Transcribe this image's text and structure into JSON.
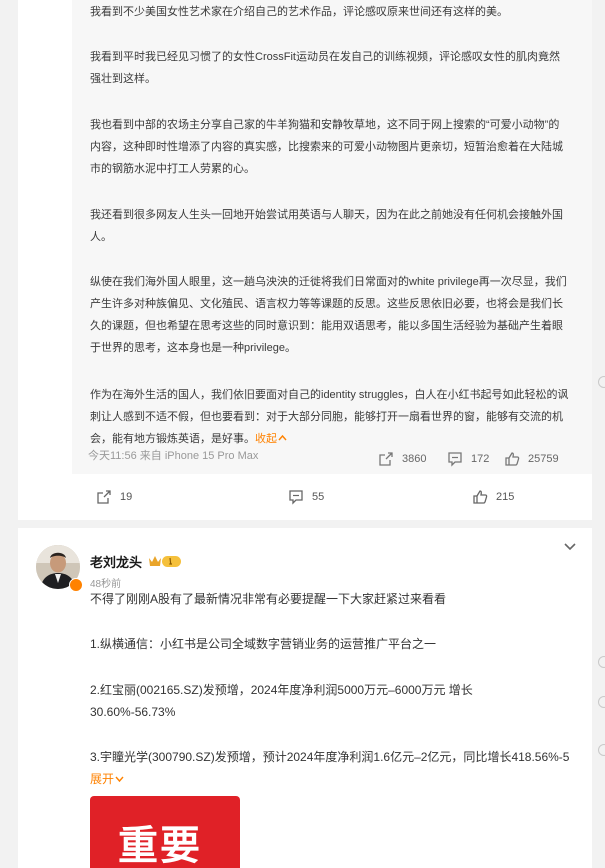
{
  "repost": {
    "paragraphs": [
      "我看到不少美国女性艺术家在介绍自己的艺术作品，评论感叹原来世间还有这样的美。",
      "我看到平时我已经见习惯了的女性CrossFit运动员在发自己的训练视频，评论感叹女性的肌肉竟然强壮到这样。",
      "我也看到中部的农场主分享自己家的牛羊狗猫和安静牧草地，这不同于网上搜索的“可爱小动物”的内容，这种即时性增添了内容的真实感，比搜索来的可爱小动物图片更亲切，短暂治愈着在大陆城市的钢筋水泥中打工人劳累的心。",
      "我还看到很多网友人生头一回地开始尝试用英语与人聊天，因为在此之前她没有任何机会接触外国人。",
      "纵使在我们海外国人眼里，这一趟乌泱泱的迁徙将我们日常面对的white privilege再一次尽显，我们产生许多对种族偏见、文化殖民、语言权力等等课题的反思。这些反思依旧必要，也将会是我们长久的课题，但也希望在思考这些的同时意识到：能用双语思考，能以多国生活经验为基础产生着眼于世界的思考，这本身也是一种privilege。",
      "作为在海外生活的国人，我们依旧要面对自己的identity struggles，白人在小红书起号如此轻松的讽刺让人感到不适不假，但也要看到：对于大部分同胞，能够打开一扇看世界的窗，能够有交流的机会，能有地方锻炼英语，是好事。"
    ],
    "collapse_label": "收起",
    "meta": "今天11:56 来自 iPhone 15 Pro Max",
    "repost_count": "3860",
    "comment_count": "172",
    "like_count": "25759"
  },
  "post1_actions": {
    "repost_count": "19",
    "comment_count": "55",
    "like_count": "215"
  },
  "post2": {
    "username": "老刘龙头",
    "time": "48秒前",
    "intro": "不得了刚刚A股有了最新情况非常有必要提醒一下大家赶紧过来看看",
    "item1": "1.纵横通信：小红书是公司全域数字营销业务的运营推广平台之一",
    "item2": "2.红宝丽(002165.SZ)发预增，2024年度净利润5000万元–6000万元 增长30.60%-56.73%",
    "item3": "3.宇瞳光学(300790.SZ)发预增，预计2024年度净利润1.6亿元–2亿元，同比增长418.56%-5",
    "expand_label": "展开",
    "image_text": "重要"
  },
  "colors": {
    "accent": "#ff8200",
    "image_red": "#e02127"
  },
  "icons": {
    "repost": "repost-icon",
    "comment": "comment-icon",
    "like": "like-icon",
    "more": "chevron-down-icon",
    "vip": "crown-icon"
  }
}
